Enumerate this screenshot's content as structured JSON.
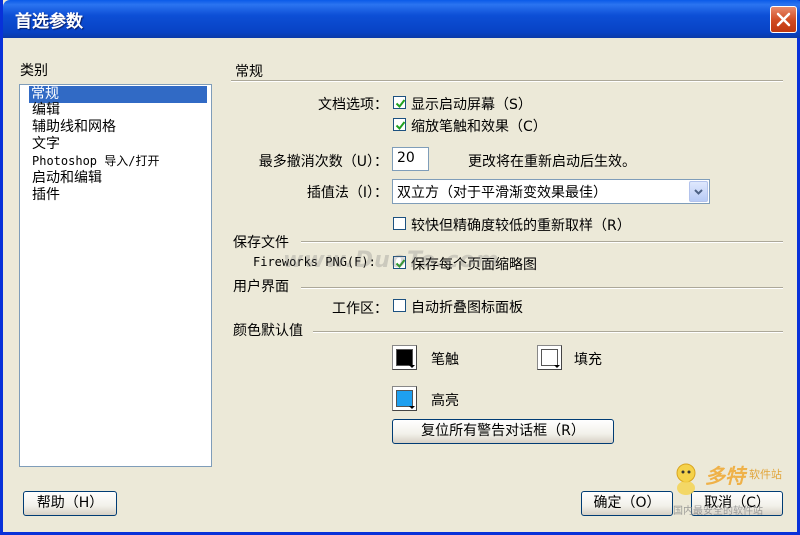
{
  "window": {
    "title": "首选参数"
  },
  "category": {
    "label": "类别",
    "items": [
      "常规",
      "编辑",
      "辅助线和网格",
      "文字",
      "Photoshop 导入/打开",
      "启动和编辑",
      "插件"
    ],
    "selected_index": 0
  },
  "general": {
    "section_title": "常规",
    "doc_options_label": "文档选项：",
    "show_startup_label": "显示启动屏幕（S）",
    "show_startup_checked": true,
    "scale_strokes_label": "缩放笔触和效果（C）",
    "scale_strokes_checked": true,
    "undo_label": "最多撤消次数（U）：",
    "undo_value": "20",
    "undo_note": "更改将在重新启动后生效。",
    "interp_label": "插值法（I）：",
    "interp_value": "双立方（对于平滑渐变效果最佳）",
    "resample_label": "较快但精确度较低的重新取样（R）",
    "resample_checked": false
  },
  "save_files": {
    "section_title": "保存文件",
    "fireworks_label": "Fireworks PNG(F):",
    "thumbnails_label": "保存每个页面缩略图",
    "thumbnails_checked": true
  },
  "ui": {
    "section_title": "用户界面",
    "workspace_label": "工作区：",
    "auto_collapse_label": "自动折叠图标面板",
    "auto_collapse_checked": false
  },
  "colors": {
    "section_title": "颜色默认值",
    "stroke_label": "笔触",
    "stroke_color": "#000000",
    "fill_label": "填充",
    "fill_color": "#ffffff",
    "highlight_label": "高亮",
    "highlight_color": "#1ea0f0",
    "reset_warnings_label": "复位所有警告对话框（R）"
  },
  "footer": {
    "help_label": "帮助（H）",
    "ok_label": "确定（O）",
    "cancel_label": "取消（C）"
  },
  "watermark": {
    "text": "www.DuoTe.com",
    "logo_text": "多特",
    "logo_sub": "软件站",
    "logo_tag": "国内最安全的软件站"
  }
}
